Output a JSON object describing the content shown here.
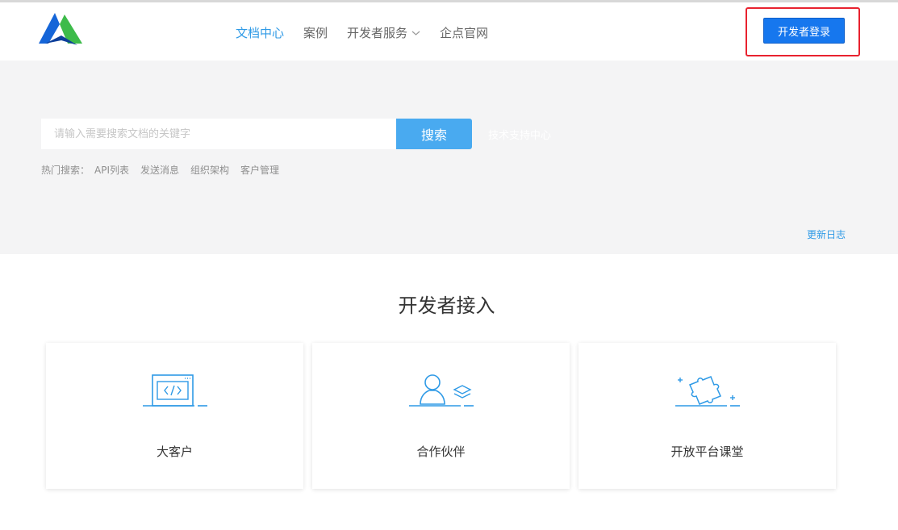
{
  "header": {
    "logo_icon": "triangle-logo-icon",
    "nav": [
      {
        "label": "文档中心",
        "active": true
      },
      {
        "label": "案例",
        "active": false
      },
      {
        "label": "开发者服务",
        "active": false
      },
      {
        "label": "企点官网",
        "active": false
      }
    ],
    "login_label": "开发者登录"
  },
  "hero": {
    "search_placeholder": "请输入需要搜索文档的关键字",
    "search_button": "搜索",
    "support_link": "技术支持中心",
    "hot_label": "热门搜索：",
    "hot_items": [
      "API列表",
      "发送消息",
      "组织架构",
      "客户管理"
    ],
    "changelog": "更新日志"
  },
  "section": {
    "title": "开发者接入",
    "cards": [
      {
        "label": "大客户",
        "icon": "code-window-icon"
      },
      {
        "label": "合作伙伴",
        "icon": "partner-user-icon"
      },
      {
        "label": "开放平台课堂",
        "icon": "puzzle-icon"
      }
    ]
  },
  "colors": {
    "accent": "#2f9ae6",
    "login_button": "#1677ee",
    "search_button": "#49aaf0",
    "hero_background": "#f4f4f5",
    "highlight_border": "#e8222f"
  }
}
